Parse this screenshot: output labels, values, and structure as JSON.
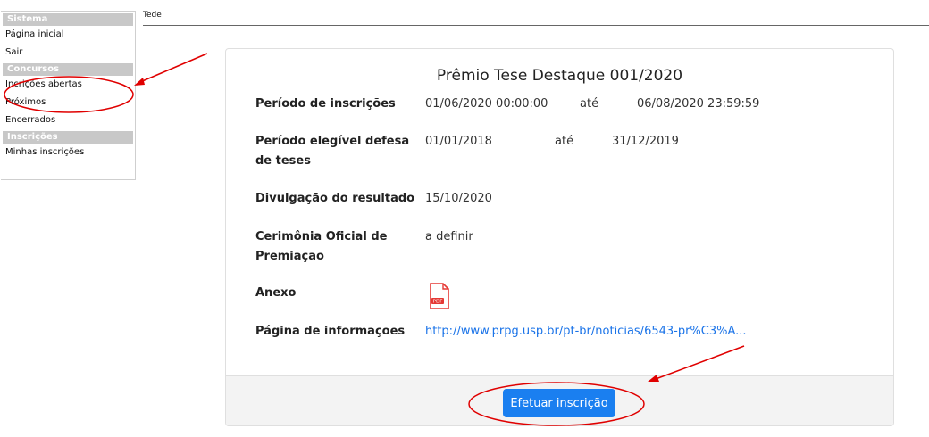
{
  "sidebar": {
    "sections": [
      {
        "header": "Sistema",
        "items": [
          "Página inicial",
          "Sair"
        ]
      },
      {
        "header": "Concursos",
        "items": [
          "Incrições abertas",
          "Próximos",
          "Encerrados"
        ]
      },
      {
        "header": "Inscrições",
        "items": [
          "Minhas inscrições"
        ]
      }
    ]
  },
  "topbar": {
    "title": "Tede"
  },
  "card": {
    "title": "Prêmio Tese Destaque 001/2020",
    "rows": {
      "periodo_inscricoes": {
        "label": "Período de inscrições",
        "start": "01/06/2020 00:00:00",
        "sep": "até",
        "end": "06/08/2020 23:59:59"
      },
      "periodo_defesa": {
        "label": "Período elegível defesa de teses",
        "start": "01/01/2018",
        "sep": "até",
        "end": "31/12/2019"
      },
      "divulgacao": {
        "label": "Divulgação do resultado",
        "value": "15/10/2020"
      },
      "cerimonia": {
        "label": "Cerimônia Oficial de Premiação",
        "value": "a definir"
      },
      "anexo": {
        "label": "Anexo",
        "icon": "pdf-file-icon",
        "icon_text": "PDF"
      },
      "pagina": {
        "label": "Página de informações",
        "link": "http://www.prpg.usp.br/pt-br/noticias/6543-pr%C3%A..."
      }
    },
    "button": "Efetuar inscrição"
  },
  "colors": {
    "accent": "#1a7ff0",
    "annotation": "#e00000",
    "section_header": "#c8c8c8"
  }
}
